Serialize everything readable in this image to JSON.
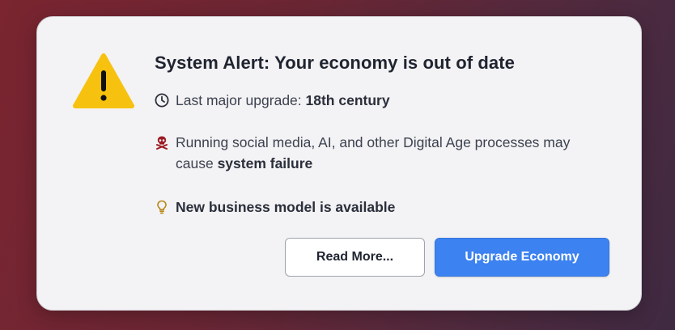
{
  "dialog": {
    "title": "System Alert: Your economy is out of date",
    "items": [
      {
        "icon": "clock-icon",
        "label": "Last major upgrade: ",
        "value": "18th century"
      },
      {
        "icon": "skull-crossbones-icon",
        "text_line1": "Running social media, AI, and other Digital Age processes may",
        "text_line2_prefix": "cause ",
        "text_line2_bold": "system failure"
      },
      {
        "icon": "lightbulb-icon",
        "bold": "New business model is available"
      }
    ],
    "buttons": {
      "read_more": "Read More...",
      "upgrade": "Upgrade Economy"
    }
  },
  "colors": {
    "warning_yellow": "#f6c20f",
    "accent_blue": "#3c82f0",
    "skull_red": "#9b1b22",
    "bulb_amber": "#b98614"
  }
}
